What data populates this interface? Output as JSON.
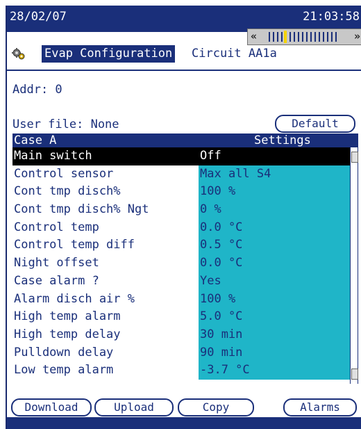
{
  "status": {
    "date": "28/02/07",
    "time": "21:03:58"
  },
  "nav": {
    "left_arrow": "«",
    "right_arrow": "»"
  },
  "header": {
    "title": "Evap Configuration",
    "subtitle": "Circuit AA1a",
    "icon": "gear-icon"
  },
  "info": {
    "addr": "Addr: 0",
    "user_file": "User file: None"
  },
  "buttons": {
    "default": "Default",
    "download": "Download",
    "upload": "Upload",
    "copy": "Copy",
    "alarms": "Alarms"
  },
  "table": {
    "col1": "Case A",
    "col2": "Settings",
    "rows": [
      {
        "label": "Main switch",
        "value": "Off"
      },
      {
        "label": "Control sensor",
        "value": "Max all S4"
      },
      {
        "label": "Cont tmp disch%",
        "value": "100 %"
      },
      {
        "label": "Cont tmp disch% Ngt",
        "value": "0 %"
      },
      {
        "label": "Control temp",
        "value": "0.0 °C"
      },
      {
        "label": "Control temp diff",
        "value": "0.5 °C"
      },
      {
        "label": "Night offset",
        "value": "0.0 °C"
      },
      {
        "label": "Case alarm ?",
        "value": "Yes"
      },
      {
        "label": "Alarm disch air %",
        "value": "100 %"
      },
      {
        "label": "High temp alarm",
        "value": "5.0 °C"
      },
      {
        "label": "High temp delay",
        "value": "30 min"
      },
      {
        "label": "Pulldown delay",
        "value": "90 min"
      },
      {
        "label": "Low temp alarm",
        "value": "-3.7 °C"
      }
    ]
  },
  "colors": {
    "navy": "#1a2f7a",
    "cyan": "#1fb5c8",
    "highlight": "#f5d400"
  }
}
